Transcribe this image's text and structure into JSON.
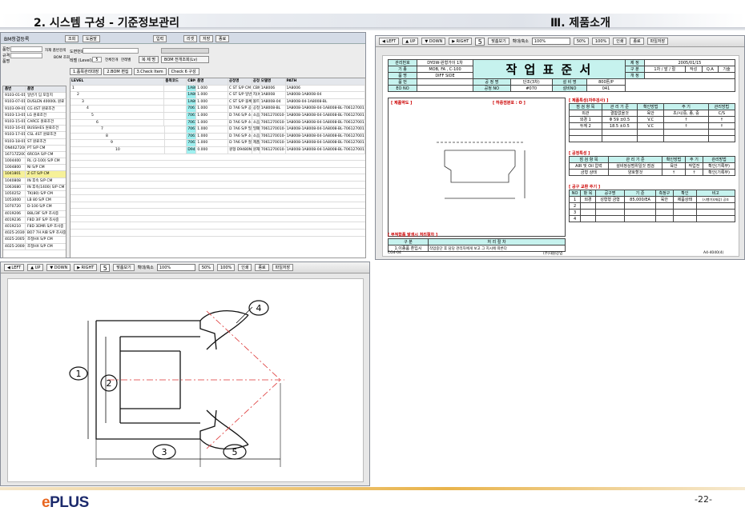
{
  "header": {
    "title_left": "2. 시스템 구성 - 기준정보관리",
    "title_right": "Ⅲ. 제품소개"
  },
  "footer": {
    "logo_e": "e",
    "logo_text": "PLUS",
    "page_number": "-22-"
  },
  "toolbar": {
    "left": "◀ LEFT",
    "up": "▲ UP",
    "down": "▼ DOWN",
    "right": "▶ RIGHT",
    "page": "5",
    "fit": "맞춤보기",
    "zoom_label": "확대/축소",
    "zoom": "100%",
    "z50": "50%",
    "z100": "100%",
    "print": "인쇄",
    "close": "종료",
    "save": "파일저장"
  },
  "app": {
    "title": "BM청결등록",
    "buttons": [
      "조회",
      "도움말",
      "입력",
      "리셋",
      "저장",
      "종료"
    ],
    "top_labels": [
      "품번",
      "규격",
      "품명",
      "도면번호"
    ],
    "search_options": [
      "자재 품번검색",
      "BOM 조회"
    ],
    "level_label": "레벨 (Level) :",
    "level_value": "5",
    "chk_expand": "전체전개",
    "chk_one": "한레벨",
    "copy_button": "복 제 명",
    "bom_button": "BOM 전개조회(Lv)",
    "tabs": [
      "1.품목관리대장",
      "2.BOM 편집",
      "3.Check Item",
      "Check 6 구성"
    ],
    "list_headers": [
      "품번",
      "품명"
    ],
    "list_rows": [
      [
        "9103-01-01",
        "일반기 딤 포장지"
      ],
      [
        "9103-07-01",
        "DUSLEN 40000L 원료"
      ],
      [
        "9103-09-01-01",
        "CG 4ST 원료조건"
      ],
      [
        "9103-13-01",
        "LG 원료조건"
      ],
      [
        "9103-15-01",
        "CARCE 원료조건"
      ],
      [
        "9103-16-01",
        "BUSSHES 원료조건"
      ],
      [
        "9103-17-01",
        "CSL 4ST 원료조건"
      ],
      [
        "9103-18-01",
        "ST 원료조건"
      ],
      [
        "ON46272000",
        "PT S/P CM"
      ],
      [
        "16717Z2000",
        "6RCOA S/P CM"
      ],
      [
        "1004400",
        "RL (2-100) S/P CM"
      ],
      [
        "1004800",
        "NI S/P CM"
      ],
      [
        "1041801",
        "Z GT S/P CM"
      ],
      [
        "1040808",
        "IN 후속 S/P CM"
      ],
      [
        "1063680",
        "IN 후속(1400) S/P CM"
      ],
      [
        "1050252",
        "TK(80) S/P CM"
      ],
      [
        "1053000",
        "LB 80 S/P CM"
      ],
      [
        "1070720",
        "D-100 S/P CM"
      ],
      [
        "4019206",
        "B8L/3IF S/P 조사중"
      ],
      [
        "4019236",
        "F8D 3IF S/P 조사중"
      ],
      [
        "4019210",
        "F8D 3EMR S/P 조사중"
      ],
      [
        "4025-20300",
        "BO7 7H AIB S/P 조사중"
      ],
      [
        "4025-20050",
        "조정HX S/P CM"
      ],
      [
        "4025-20000",
        "조정HX S/P CM"
      ]
    ],
    "grid_headers": [
      "LEVEL",
      "품목코드",
      "CBM",
      "품명",
      "공정명",
      "공정",
      "모델명",
      "PATH"
    ],
    "grid_rows": [
      [
        "1",
        "",
        "1A8008",
        "1.000",
        "C ST S/P CM",
        "CBM",
        "1A8006",
        "1A8006"
      ],
      [
        "2",
        "",
        "1A8008-04",
        "1.000",
        "C ST S/P 일반",
        "지(X)공판-일반판",
        "1A8008",
        "1A8008-1A8008-04"
      ],
      [
        "3",
        "",
        "1A8008-BL",
        "1.000",
        "C ST S/P 블록",
        "볼트",
        "1A8008-04",
        "1A8008-04-1A8008-BL"
      ],
      [
        "4",
        "",
        "7061270010-4",
        "1.000",
        "D 7A6 S/P 공정(중간)",
        "공정(중간)",
        "1A8008-BL",
        "1A8008-1A8008-04-1A8008-BL-7061270010-P1"
      ],
      [
        "5",
        "",
        "7061270010-42",
        "1.000",
        "D 7A6 S/P 소음(레이져)",
        "소음(레이져)",
        "7061270010-4",
        "1A8008-1A8008-04-1A8008-BL-7061270010-P1"
      ],
      [
        "6",
        "",
        "7061270010-43",
        "1.000",
        "D 7A6 S/P 소음(레이져)",
        "소음(레이져)",
        "7061270010-42",
        "1A8008-1A8008-04-1A8008-BL-7061270010-P1"
      ],
      [
        "7",
        "",
        "7061270010-41",
        "1.000",
        "D 7A6 S/P 밀폐(연기)",
        "밀폐(연기)",
        "7061270010-43",
        "1A8008-1A8008-04-1A8008-BL-7061270010-P1"
      ],
      [
        "8",
        "",
        "7061270010-44",
        "1.000",
        "D 7A6 S/P 소음(레이져)",
        "소음(레이져)",
        "7061270010-41",
        "1A8008-1A8008-04-1A8008-BL-7061270010-P1"
      ],
      [
        "9",
        "",
        "7061270010-40",
        "1.000",
        "D 7A6 S/P 절단",
        "제품(절단)",
        "7061270010-44",
        "1A8008-1A8008-04-1A8008-BL-7061270010-P1"
      ],
      [
        "10",
        "",
        "D9480N-07-3",
        "0.000",
        "원형 D9480N-07-3",
        "원재",
        "7061270010-40",
        "1A8008-1A8008-04-1A8008-BL-7061270010-P1"
      ]
    ]
  },
  "doc": {
    "title": "작 업 표 준 서",
    "manage_no_label": "관리번호",
    "manage_no": "DYOW-원형가이 1차",
    "model_label": "기 종",
    "model": "MOB, FA , C-100",
    "name_label": "품 명",
    "name": "DIFF SIDE",
    "kind_label": "품 번",
    "eo_label": "EO NO",
    "process_label": "공 정 명",
    "process": "단조(3차)",
    "equip_label": "설 비 명",
    "equip": "800톤/P",
    "proc_no_label": "공정 NO",
    "proc_no": "#070",
    "equip_no_label": "설비NO",
    "equip_no": "041",
    "date_label": "제 정",
    "date": "2005/01/15",
    "rev_label": "구 분",
    "rev": "1차 / 발 / 절",
    "sign": [
      "작성",
      "Q.A",
      "기술",
      "승인"
    ],
    "change_label": "개 정",
    "s_sketch": "[ 제품약도 ]",
    "s_cut": "[ 하중점분포 : O ]",
    "s_product": "[ 제품특성(자주검사) ]",
    "prod_head": [
      "점 검 항 목",
      "관 리 기 준",
      "확인방법",
      "주 기",
      "관리방법"
    ],
    "prod_rows": [
      [
        "외관",
        "결함없을것",
        "육안",
        "초/시/중, 종, 중",
        "C/S"
      ],
      [
        "외경 1",
        "Φ 59 ±0.5",
        "V.C",
        "↑",
        "↑"
      ],
      [
        "두께 2",
        "18.5 ±0.5",
        "V.C",
        "↑",
        "↑"
      ]
    ],
    "s_process": "[ 공정특성 ]",
    "proc_head": [
      "점 검 항 목",
      "관 리 기 준",
      "확인방법",
      "주 기",
      "관리방법"
    ],
    "proc_rows": [
      [
        "AIR 및 Oil 압력",
        "설비정상범위일것 점검",
        "육안",
        "작업전",
        "확인(기록무)"
      ],
      [
        "금형 상태",
        "양호할것",
        "↑",
        "↑",
        "확인(기록무)"
      ]
    ],
    "s_tool": "[ 공구 교환 주기 ]",
    "tool_head": [
      "NO",
      "항 목",
      "공구명",
      "기 준",
      "측정구",
      "확인",
      "비고"
    ],
    "tool_rows": [
      [
        "1",
        "외경",
        "성형형 금형",
        "85,000/EA",
        "육안",
        "제품상태",
        "(시행가)(재감) 공조"
      ],
      [
        "2",
        "",
        "",
        "",
        "",
        "",
        ""
      ],
      [
        "3",
        "",
        "",
        "",
        "",
        "",
        ""
      ],
      [
        "4",
        "",
        "",
        "",
        "",
        "",
        ""
      ]
    ],
    "s_abn": "[ 부적합품 발생시 처리절차 ]",
    "abn_head": [
      "구 분",
      "처 리 절 차"
    ],
    "abn_rows": [
      [
        "1.이종품 혼입시",
        "작업중단 후 담당 관리자에게 보고 그 지시에 따른다"
      ],
      [
        "2.제품불량 발생시",
        "작업중단 후 불량품 별도보관, 부적합품 보관장소로 이동 품질담당에게 보고 그 지시에 따른다"
      ]
    ],
    "footer_left": "CG4-04",
    "footer_mid": "(주)대원강업",
    "footer_right": "A4-4040(4)"
  },
  "drawing": {
    "labels": [
      "1",
      "2",
      "3",
      "4",
      "5"
    ]
  }
}
